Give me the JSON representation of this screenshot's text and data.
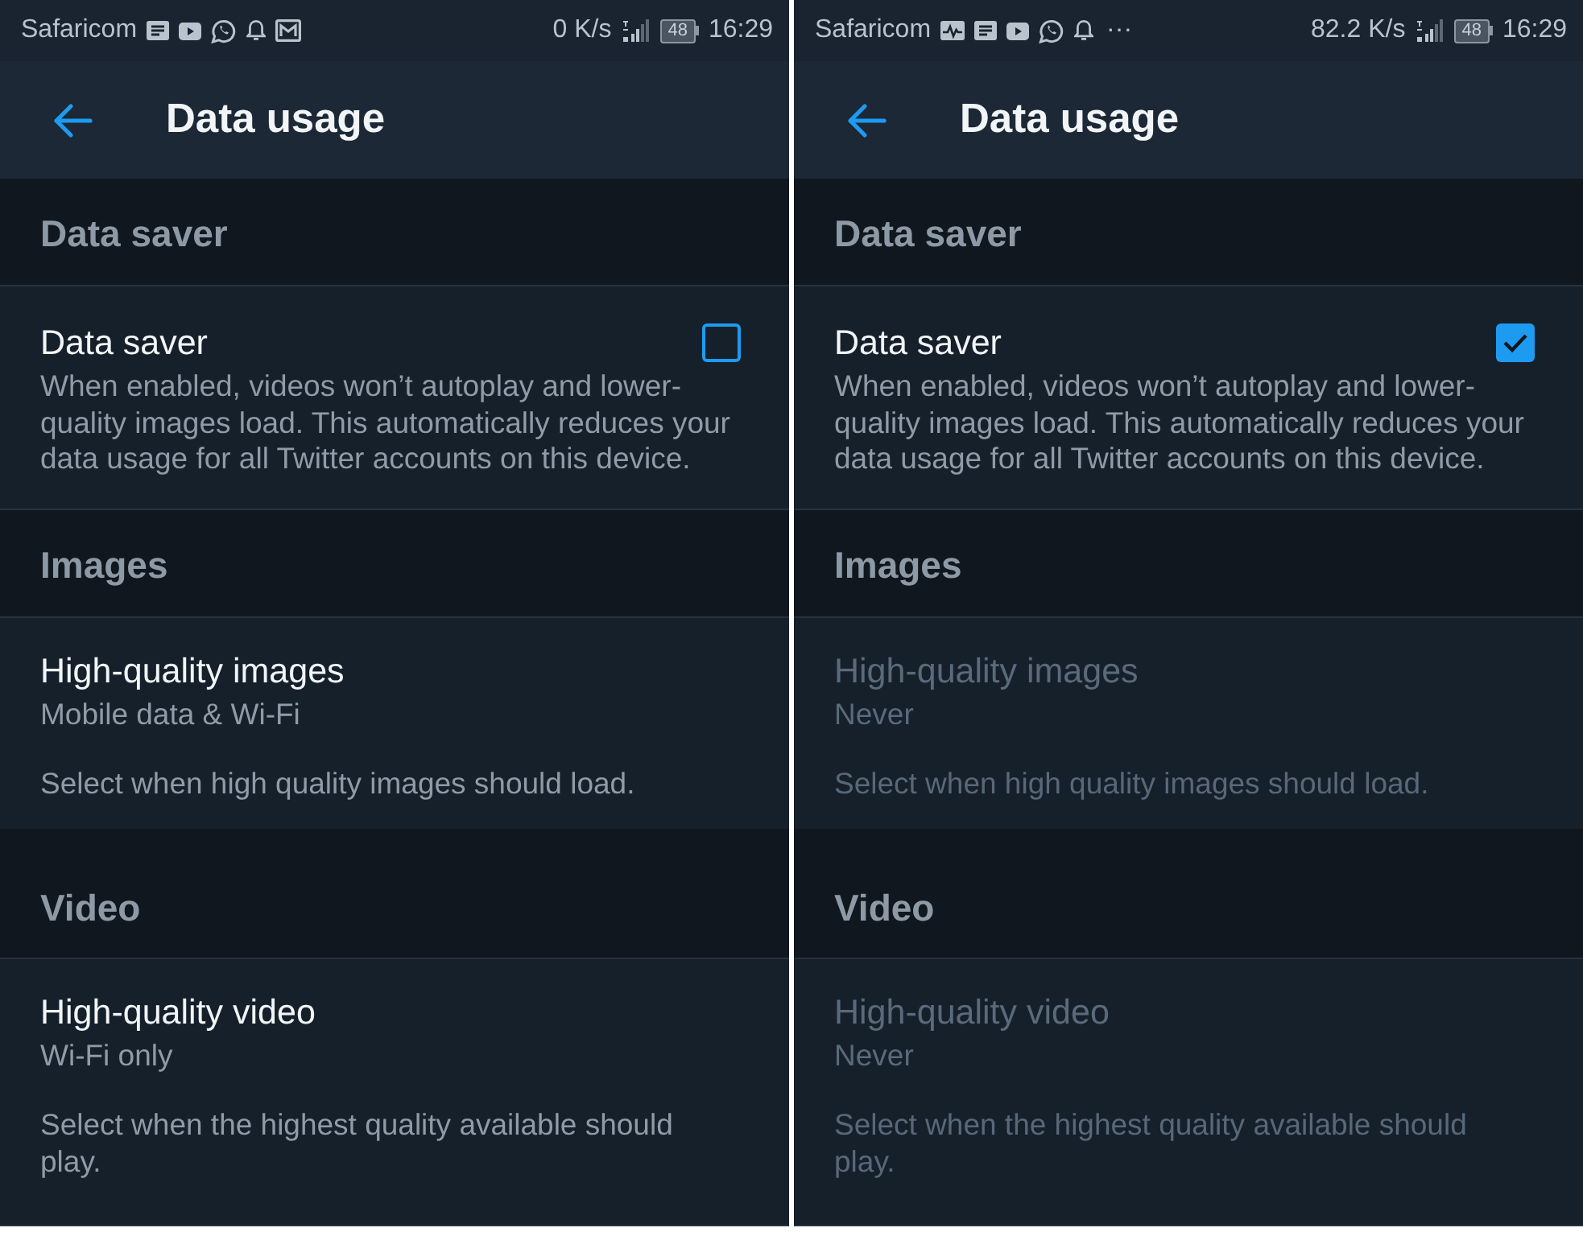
{
  "screens": [
    {
      "status_bar": {
        "carrier": "Safaricom",
        "notification_icons": [
          {
            "kind": "notes"
          },
          {
            "kind": "play"
          },
          {
            "kind": "chat"
          },
          {
            "kind": "bell"
          },
          {
            "kind": "image"
          }
        ],
        "speed": "0 K/s",
        "battery": "48",
        "time": "16:29"
      },
      "header": {
        "title": "Data usage"
      },
      "sections": [
        {
          "title": "Data saver",
          "items": [
            {
              "kind": "checkbox",
              "title": "Data saver",
              "description": "When enabled, videos won’t autoplay and lower-quality images load. This automatically reduces your data usage for all Twitter accounts on this device.",
              "checked": false
            }
          ]
        },
        {
          "title": "Images",
          "items": [
            {
              "kind": "choice",
              "title": "High-quality images",
              "value": "Mobile data & Wi-Fi",
              "description": "Select when high quality images should load.",
              "disabled": false
            }
          ]
        },
        {
          "title": "Video",
          "items": [
            {
              "kind": "choice",
              "title": "High-quality video",
              "value": "Wi-Fi only",
              "description": "Select when the highest quality available should play.",
              "disabled": false
            }
          ]
        }
      ]
    },
    {
      "status_bar": {
        "carrier": "Safaricom",
        "notification_icons": [
          {
            "kind": "pulse"
          },
          {
            "kind": "notes"
          },
          {
            "kind": "play"
          },
          {
            "kind": "chat"
          },
          {
            "kind": "bell"
          }
        ],
        "overflow": "···",
        "speed": "82.2 K/s",
        "battery": "48",
        "time": "16:29"
      },
      "header": {
        "title": "Data usage"
      },
      "sections": [
        {
          "title": "Data saver",
          "items": [
            {
              "kind": "checkbox",
              "title": "Data saver",
              "description": "When enabled, videos won’t autoplay and lower-quality images load. This automatically reduces your data usage for all Twitter accounts on this device.",
              "checked": true
            }
          ]
        },
        {
          "title": "Images",
          "items": [
            {
              "kind": "choice",
              "title": "High-quality images",
              "value": "Never",
              "description": "Select when high quality images should load.",
              "disabled": true
            }
          ]
        },
        {
          "title": "Video",
          "items": [
            {
              "kind": "choice",
              "title": "High-quality video",
              "value": "Never",
              "description": "Select when the highest quality available should play.",
              "disabled": true
            }
          ]
        }
      ]
    }
  ]
}
